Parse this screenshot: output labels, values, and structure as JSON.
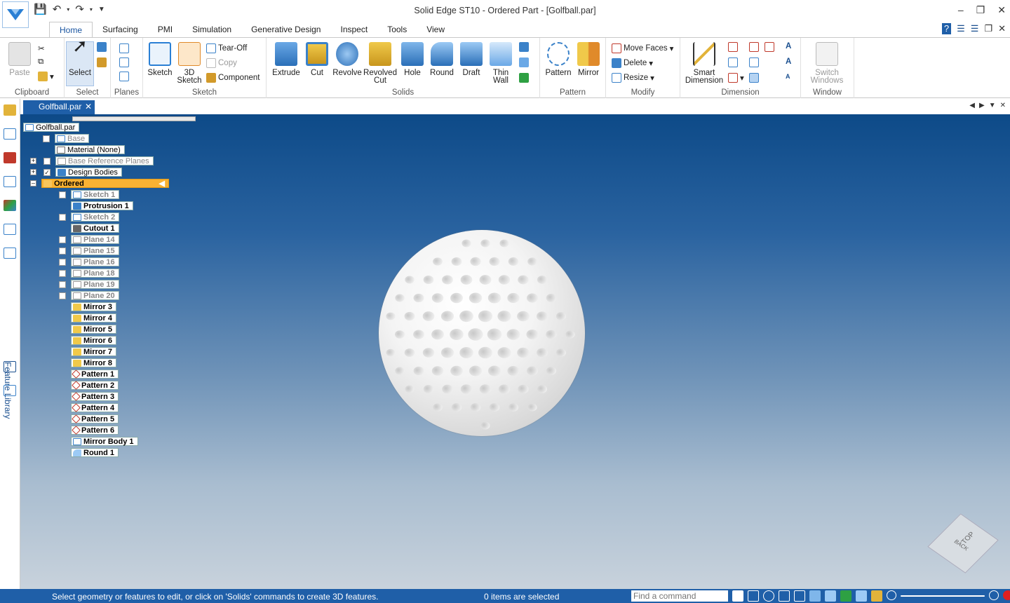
{
  "window": {
    "title": "Solid Edge ST10 - Ordered Part - [Golfball.par]"
  },
  "ribbon_tabs": [
    "Home",
    "Surfacing",
    "PMI",
    "Simulation",
    "Generative Design",
    "Inspect",
    "Tools",
    "View"
  ],
  "ribbon": {
    "clipboard": {
      "paste": "Paste",
      "group": "Clipboard"
    },
    "select": {
      "select": "Select",
      "group": "Select"
    },
    "planes": {
      "group": "Planes"
    },
    "sketch": {
      "sketch": "Sketch",
      "sketch3d_1": "3D",
      "sketch3d_2": "Sketch",
      "tearoff": "Tear-Off",
      "copy": "Copy",
      "component": "Component",
      "group": "Sketch"
    },
    "solids": {
      "extrude": "Extrude",
      "cut": "Cut",
      "revolve": "Revolve",
      "revolved_cut_1": "Revolved",
      "revolved_cut_2": "Cut",
      "hole": "Hole",
      "round": "Round",
      "draft": "Draft",
      "thinwall_1": "Thin",
      "thinwall_2": "Wall",
      "group": "Solids"
    },
    "pattern": {
      "pattern": "Pattern",
      "mirror": "Mirror",
      "group": "Pattern"
    },
    "modify": {
      "move_faces": "Move Faces",
      "delete": "Delete",
      "resize": "Resize",
      "group": "Modify"
    },
    "dimension": {
      "smart_1": "Smart",
      "smart_2": "Dimension",
      "group": "Dimension"
    },
    "window": {
      "switch_1": "Switch",
      "switch_2": "Windows",
      "group": "Window"
    }
  },
  "sidebar": {
    "feature_library": "Feature Library"
  },
  "document_tab": {
    "name": "Golfball.par"
  },
  "tree": {
    "root": "Golfball.par",
    "base": "Base",
    "material": "Material (None)",
    "ref_planes": "Base Reference Planes",
    "design_bodies": "Design Bodies",
    "ordered": "Ordered",
    "features": [
      "Sketch 1",
      "Protrusion 1",
      "Sketch 2",
      "Cutout 1",
      "Plane 14",
      "Plane 15",
      "Plane 16",
      "Plane 18",
      "Plane 19",
      "Plane 20",
      "Mirror 3",
      "Mirror 4",
      "Mirror 5",
      "Mirror 6",
      "Mirror 7",
      "Mirror 8",
      "Pattern 1",
      "Pattern 2",
      "Pattern 3",
      "Pattern 4",
      "Pattern 5",
      "Pattern 6",
      "Mirror Body 1",
      "Round 1"
    ]
  },
  "navcube": {
    "top": "TOP",
    "back": "BACK"
  },
  "status": {
    "prompt": "Select geometry or features to edit, or click on 'Solids' commands to create 3D features.",
    "selection": "0 items are selected",
    "find_placeholder": "Find a command"
  },
  "colors": {
    "accent": "#1f5fa8",
    "ordered_highlight": "#f9b233",
    "viewport_top": "#0d4a88",
    "viewport_bottom": "#c8d2dc"
  }
}
